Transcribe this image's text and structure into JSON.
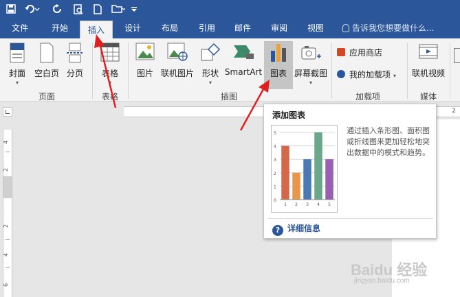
{
  "quick_access": {
    "icons": [
      "save-icon",
      "undo-icon",
      "redo-icon",
      "print-preview-icon",
      "new-document-icon",
      "open-folder-icon",
      "customize-icon"
    ]
  },
  "tabs": [
    {
      "label": "文件",
      "active": false
    },
    {
      "label": "开始",
      "active": false
    },
    {
      "label": "插入",
      "active": true
    },
    {
      "label": "设计",
      "active": false
    },
    {
      "label": "布局",
      "active": false
    },
    {
      "label": "引用",
      "active": false
    },
    {
      "label": "邮件",
      "active": false
    },
    {
      "label": "审阅",
      "active": false
    },
    {
      "label": "视图",
      "active": false
    }
  ],
  "tell_me": "告诉我您想要做什么...",
  "ribbon": {
    "pages_group": {
      "label": "页面",
      "buttons": [
        "封面",
        "空白页",
        "分页"
      ]
    },
    "table_group": {
      "label": "表格",
      "buttons": [
        "表格"
      ]
    },
    "illustrations_group": {
      "label": "插图",
      "buttons": [
        "图片",
        "联机图片",
        "形状",
        "SmartArt",
        "图表",
        "屏幕截图"
      ]
    },
    "addins_group": {
      "label": "加载项",
      "buttons": [
        "应用商店",
        "我的加载项"
      ]
    },
    "media_group": {
      "label": "媒体",
      "buttons": [
        "联机视频"
      ]
    }
  },
  "ruler": {
    "h_label": "2",
    "v_labels": [
      "4",
      "2",
      "2",
      "4",
      "6"
    ]
  },
  "tooltip": {
    "title": "添加图表",
    "description": "通过插入条形图、面积图或折线图来更加轻松地突出数据中的模式和趋势。",
    "help_label": "详细信息"
  },
  "chart_data": {
    "type": "bar",
    "categories": [
      "1",
      "2",
      "3",
      "4",
      "5"
    ],
    "values": [
      4,
      2,
      3,
      5,
      3
    ],
    "ylim": [
      0,
      5
    ],
    "yticks": [
      "0",
      "1",
      "2",
      "3",
      "4",
      "5"
    ],
    "colors": [
      "#d4684a",
      "#e8964a",
      "#4a7ab5",
      "#6aa88c",
      "#9a5fb3"
    ],
    "grid": true
  },
  "watermark": {
    "text": "Baidu 经验",
    "sub": "jingyan.baidu.com"
  },
  "colors": {
    "accent": "#2b579a",
    "arrow": "#e02020"
  }
}
